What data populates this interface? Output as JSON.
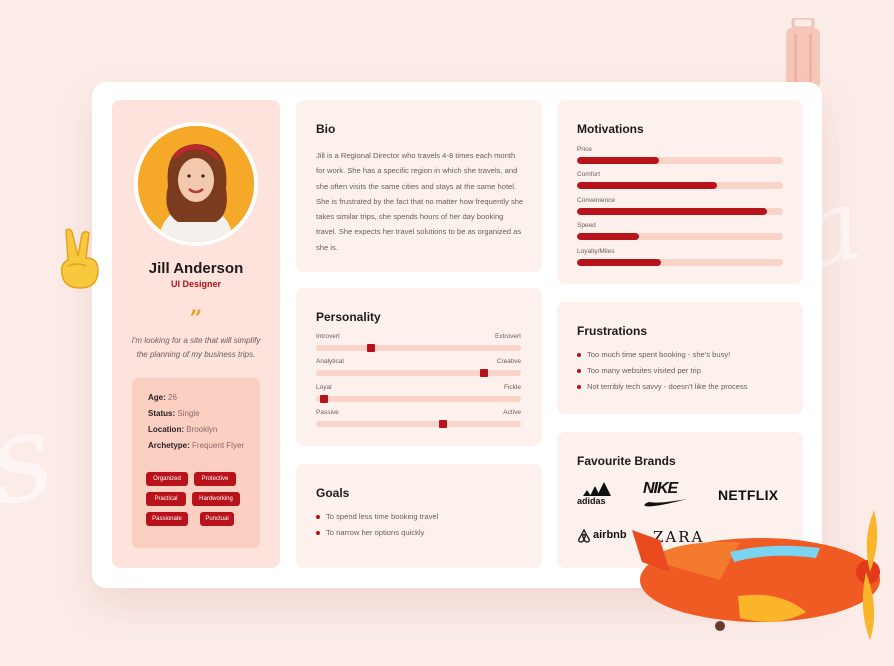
{
  "profile": {
    "name": "Jill Anderson",
    "role": "UI Designer",
    "quote_mark": "”",
    "quote": "I'm looking for a site that will simplify the planning of my business trips.",
    "details": [
      {
        "label": "Age:",
        "value": "26"
      },
      {
        "label": "Status:",
        "value": "Single"
      },
      {
        "label": "Location:",
        "value": "Brooklyn"
      },
      {
        "label": "Archetype:",
        "value": "Frequent Flyer"
      }
    ],
    "tags": [
      "Organized",
      "Protective",
      "Practical",
      "Hardworking",
      "Passionate",
      "Punctual"
    ]
  },
  "bio": {
    "title": "Bio",
    "text": "Jill is a Regional Director who travels 4-8 times each month for work. She has a specific region in which she travels, and she often visits the same cities and stays at the same hotel. She is frustrated by the fact that no matter how frequently she takes similar trips, she spends hours of her day booking travel. She expects her travel solutions to be as organized as she is."
  },
  "personality": {
    "title": "Personality",
    "traits": [
      {
        "left": "Introvert",
        "right": "Extrovert",
        "value": 0.27
      },
      {
        "left": "Analytical",
        "right": "Creative",
        "value": 0.82
      },
      {
        "left": "Loyal",
        "right": "Fickle",
        "value": 0.04
      },
      {
        "left": "Passive",
        "right": "Active",
        "value": 0.62
      }
    ]
  },
  "goals": {
    "title": "Goals",
    "items": [
      "To spend less time booking travel",
      "To narrow her options quickly"
    ]
  },
  "motivations": {
    "title": "Motivations",
    "items": [
      {
        "label": "Price",
        "value": 0.4
      },
      {
        "label": "Comfort",
        "value": 0.68
      },
      {
        "label": "Convenience",
        "value": 0.92
      },
      {
        "label": "Speed",
        "value": 0.3
      },
      {
        "label": "Loyalty/Miles",
        "value": 0.41
      }
    ]
  },
  "frustrations": {
    "title": "Frustrations",
    "items": [
      "Too much time spent booking - she's busy!",
      "Too many websites visited per trip",
      "Not terribly tech savvy - doesn't like the process"
    ]
  },
  "brands": {
    "title": "Favourite Brands",
    "items": [
      "adidas",
      "NIKE",
      "NETFLIX",
      "airbnb",
      "ZARA"
    ]
  },
  "colors": {
    "accent": "#b8121b",
    "panel": "#fdf1ee",
    "track": "#fad3c9",
    "background": "#fbece8"
  }
}
